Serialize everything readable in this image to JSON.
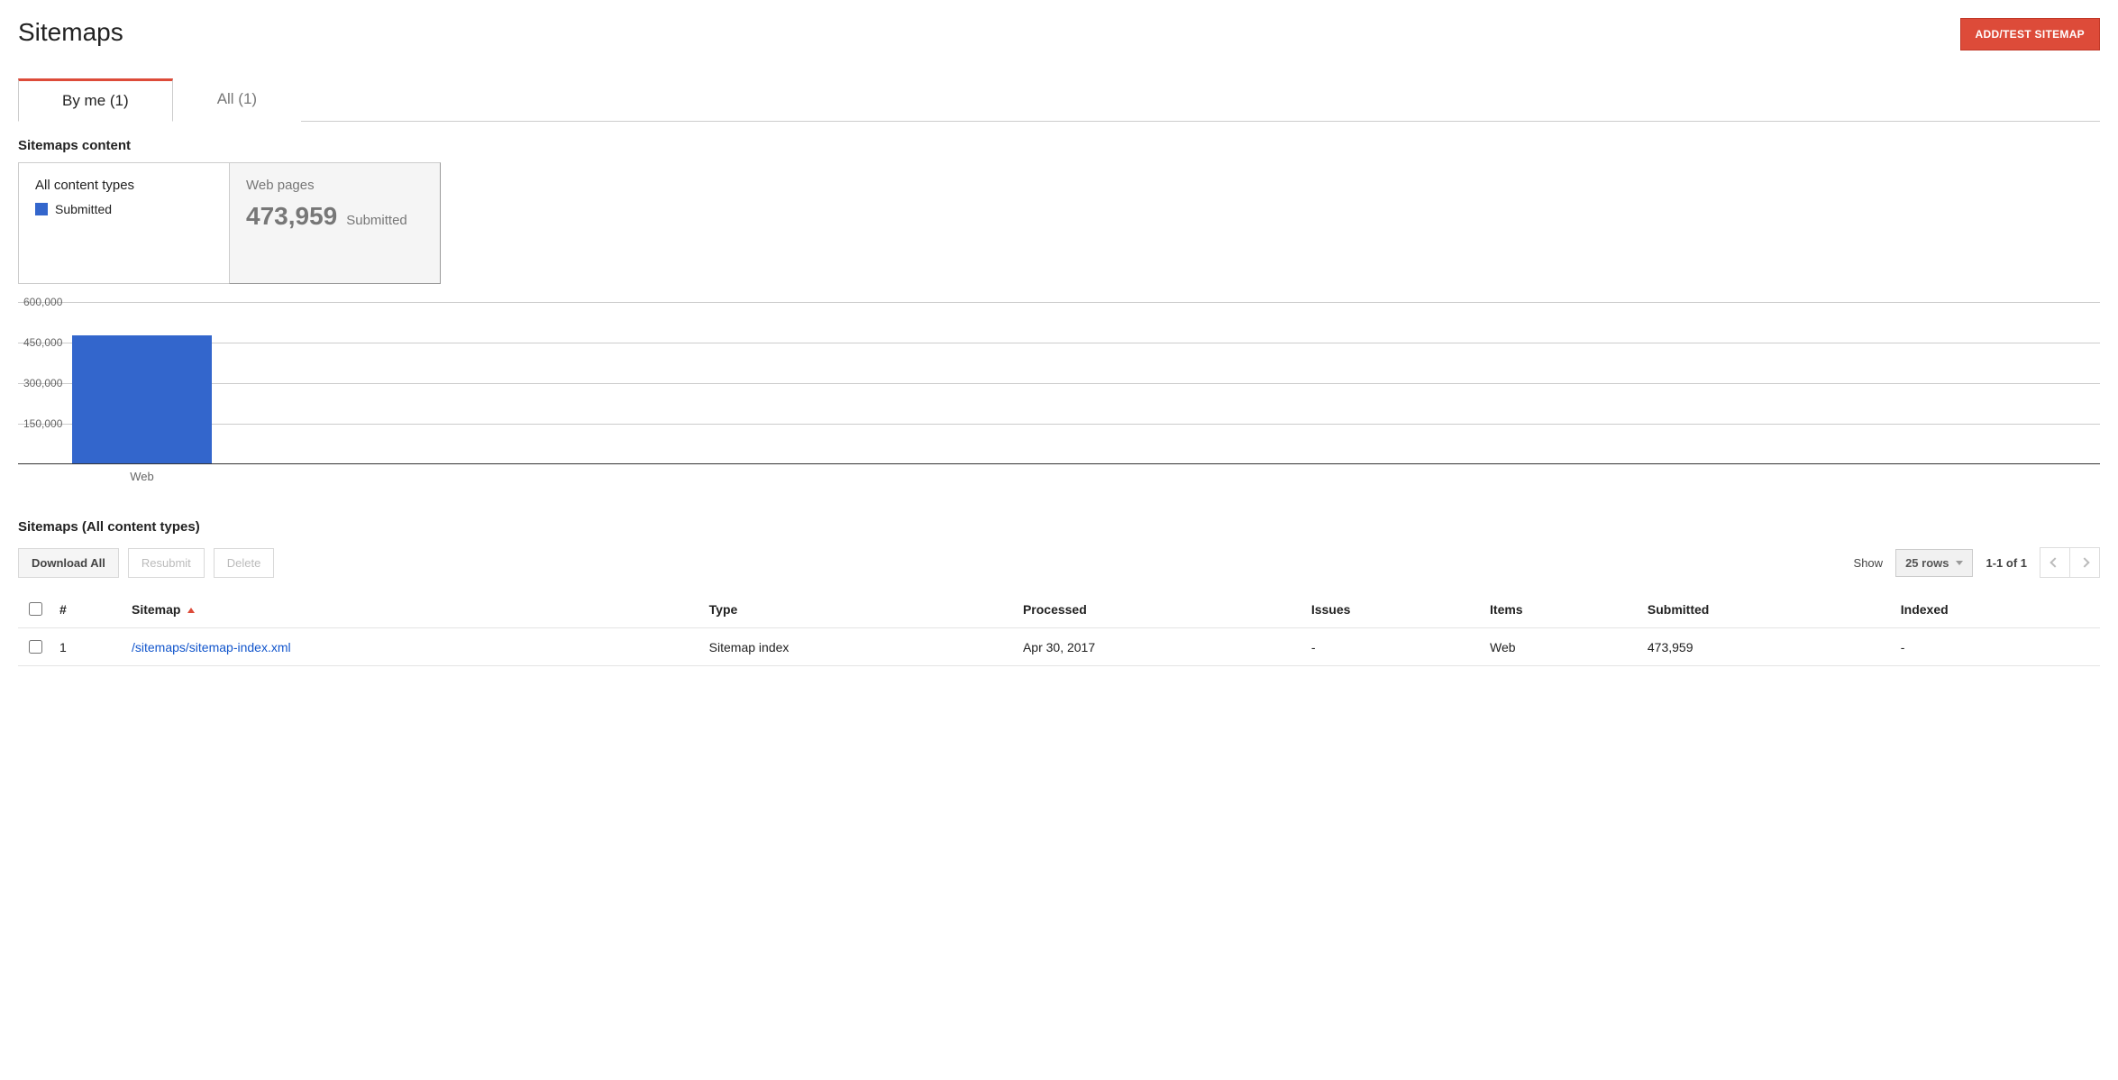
{
  "header": {
    "title": "Sitemaps",
    "add_button": "ADD/TEST SITEMAP"
  },
  "tabs": [
    {
      "label": "By me (1)",
      "active": true
    },
    {
      "label": "All (1)",
      "active": false
    }
  ],
  "content_section": {
    "title": "Sitemaps content",
    "all_types_card": {
      "heading": "All content types",
      "legend_label": "Submitted"
    },
    "web_pages_card": {
      "heading": "Web pages",
      "value": "473,959",
      "value_label": "Submitted"
    }
  },
  "chart_data": {
    "type": "bar",
    "categories": [
      "Web"
    ],
    "series": [
      {
        "name": "Submitted",
        "values": [
          473959
        ]
      }
    ],
    "yticks": [
      "150,000",
      "300,000",
      "450,000",
      "600,000"
    ],
    "ylim": [
      0,
      600000
    ],
    "xlabel": "",
    "ylabel": ""
  },
  "table_section": {
    "title": "Sitemaps (All content types)",
    "toolbar": {
      "download_all": "Download All",
      "resubmit": "Resubmit",
      "delete": "Delete",
      "show_label": "Show",
      "rows_select": "25 rows",
      "range": "1-1 of 1"
    },
    "columns": {
      "num": "#",
      "sitemap": "Sitemap",
      "type": "Type",
      "processed": "Processed",
      "issues": "Issues",
      "items": "Items",
      "submitted": "Submitted",
      "indexed": "Indexed"
    },
    "rows": [
      {
        "num": "1",
        "sitemap": "/sitemaps/sitemap-index.xml",
        "type": "Sitemap index",
        "processed": "Apr 30, 2017",
        "issues": "-",
        "items": "Web",
        "submitted": "473,959",
        "indexed": "-"
      }
    ]
  }
}
